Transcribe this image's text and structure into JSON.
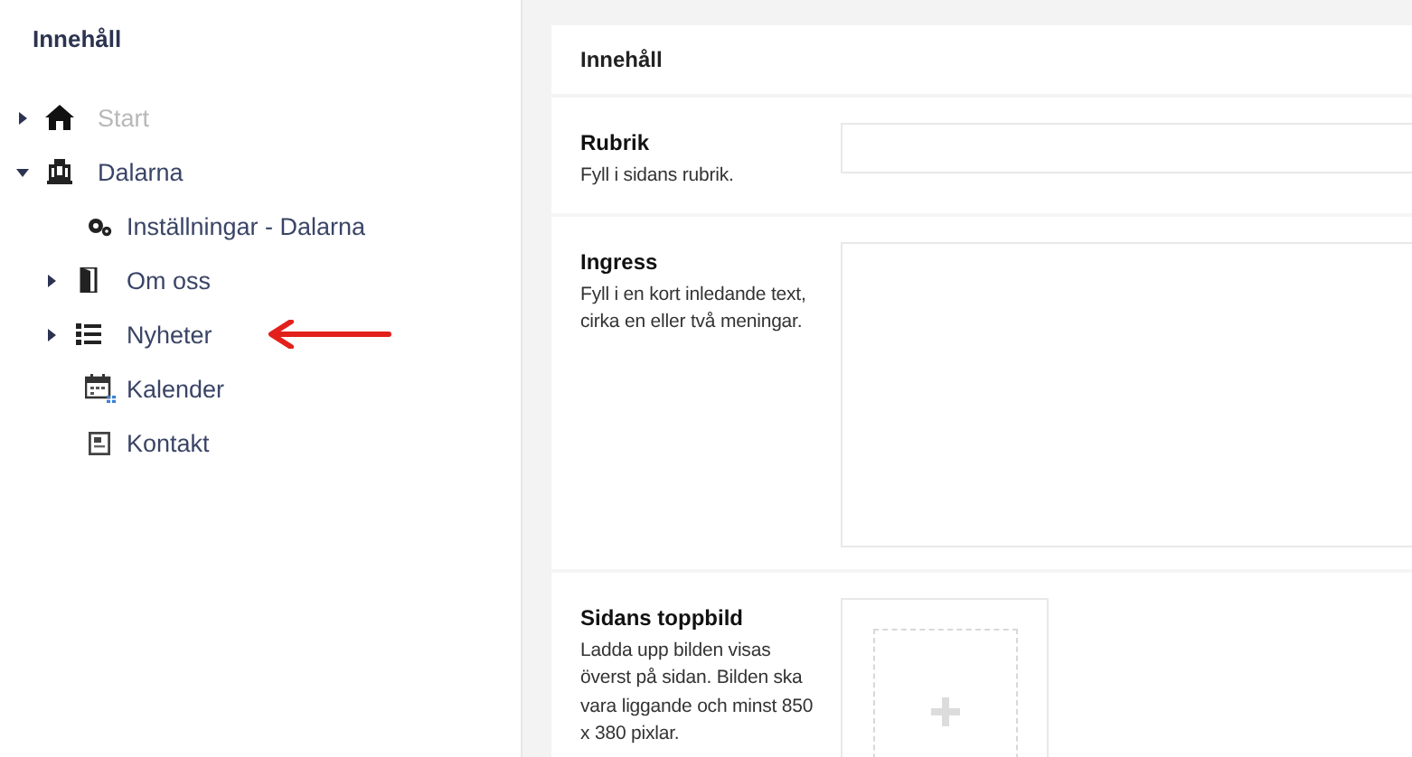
{
  "sidebar": {
    "title": "Innehåll",
    "tree": [
      {
        "label": "Start",
        "kind": "home",
        "expanded": false,
        "disabled": true,
        "marked": false
      },
      {
        "label": "Dalarna",
        "kind": "building",
        "expanded": true,
        "disabled": false,
        "marked": false,
        "children": [
          {
            "label": "Inställningar - Dalarna",
            "kind": "gears",
            "disabled": false,
            "marked": false
          },
          {
            "label": "Om oss",
            "kind": "door",
            "expanded": false,
            "disabled": false,
            "marked": false
          },
          {
            "label": "Nyheter",
            "kind": "list",
            "expanded": false,
            "disabled": false,
            "marked": true
          },
          {
            "label": "Kalender",
            "kind": "calendar",
            "disabled": false,
            "marked": false
          },
          {
            "label": "Kontakt",
            "kind": "contact",
            "disabled": false,
            "marked": false
          }
        ]
      }
    ]
  },
  "panel": {
    "title": "Innehåll",
    "fields": [
      {
        "kind": "text",
        "label": "Rubrik",
        "help": "Fyll i sidans rubrik."
      },
      {
        "kind": "textarea",
        "label": "Ingress",
        "help": "Fyll i en kort inledande text, cirka en eller två meningar."
      },
      {
        "kind": "image",
        "label": "Sidans toppbild",
        "help": "Ladda upp bilden visas överst på sidan. Bilden ska vara liggande och minst 850 x 380 pixlar."
      }
    ]
  }
}
